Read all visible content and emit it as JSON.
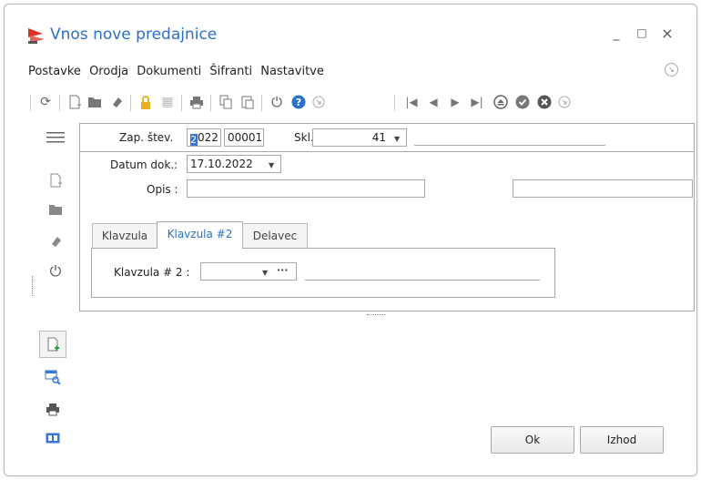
{
  "window": {
    "title": "Vnos nove predajnice",
    "minimize": "_",
    "maximize": "□",
    "close": "×"
  },
  "menu": {
    "items": [
      "Postavke",
      "Orodja",
      "Dokumenti",
      "Šifranti",
      "Nastavitve"
    ]
  },
  "form": {
    "zap_label": "Zap. štev.",
    "zap_year_caret": "2",
    "zap_year_rest": "022",
    "zap_number": "00001",
    "skl_label": "Skl.",
    "skl_value": "41",
    "datum_label": "Datum dok.:",
    "datum_value": "17.10.2022",
    "opis_label": "Opis :",
    "opis_value": ""
  },
  "tabs": [
    {
      "label": "Klavzula",
      "active": false
    },
    {
      "label": "Klavzula #2",
      "active": true
    },
    {
      "label": "Delavec",
      "active": false
    }
  ],
  "tab_content": {
    "klavzula2_label": "Klavzula # 2 :",
    "klavzula2_value": "",
    "ellipsis": "···"
  },
  "buttons": {
    "ok": "Ok",
    "izhod": "Izhod"
  },
  "colors": {
    "title": "#2a6fc9",
    "accent_blue": "#3b74d6",
    "lock_yellow": "#e8b020",
    "help_blue": "#2a6fc9",
    "add_green": "#2d9c3c"
  }
}
